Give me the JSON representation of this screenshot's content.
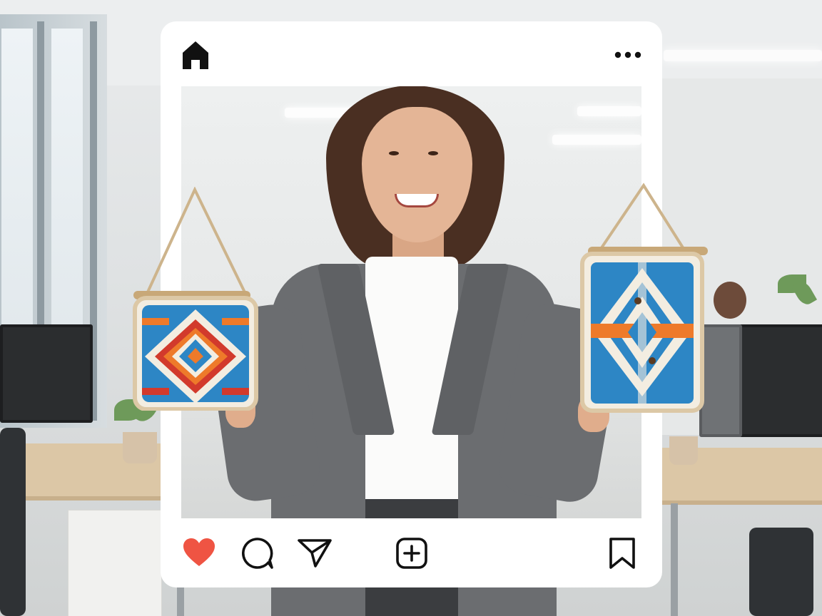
{
  "post": {
    "top_bar": {
      "home_icon": "home-icon",
      "more_icon": "more-horizontal-icon"
    },
    "action_bar": {
      "like_icon": "heart-icon",
      "comment_icon": "comment-bubble-icon",
      "share_icon": "paper-plane-icon",
      "add_icon": "add-square-icon",
      "save_icon": "bookmark-icon",
      "like_color": "#ef5443"
    }
  },
  "palette": {
    "macrame_blue": "#2d86c5",
    "macrame_orange": "#ee7a2a",
    "macrame_red": "#d23a2c",
    "macrame_cream": "#f3ede1"
  }
}
